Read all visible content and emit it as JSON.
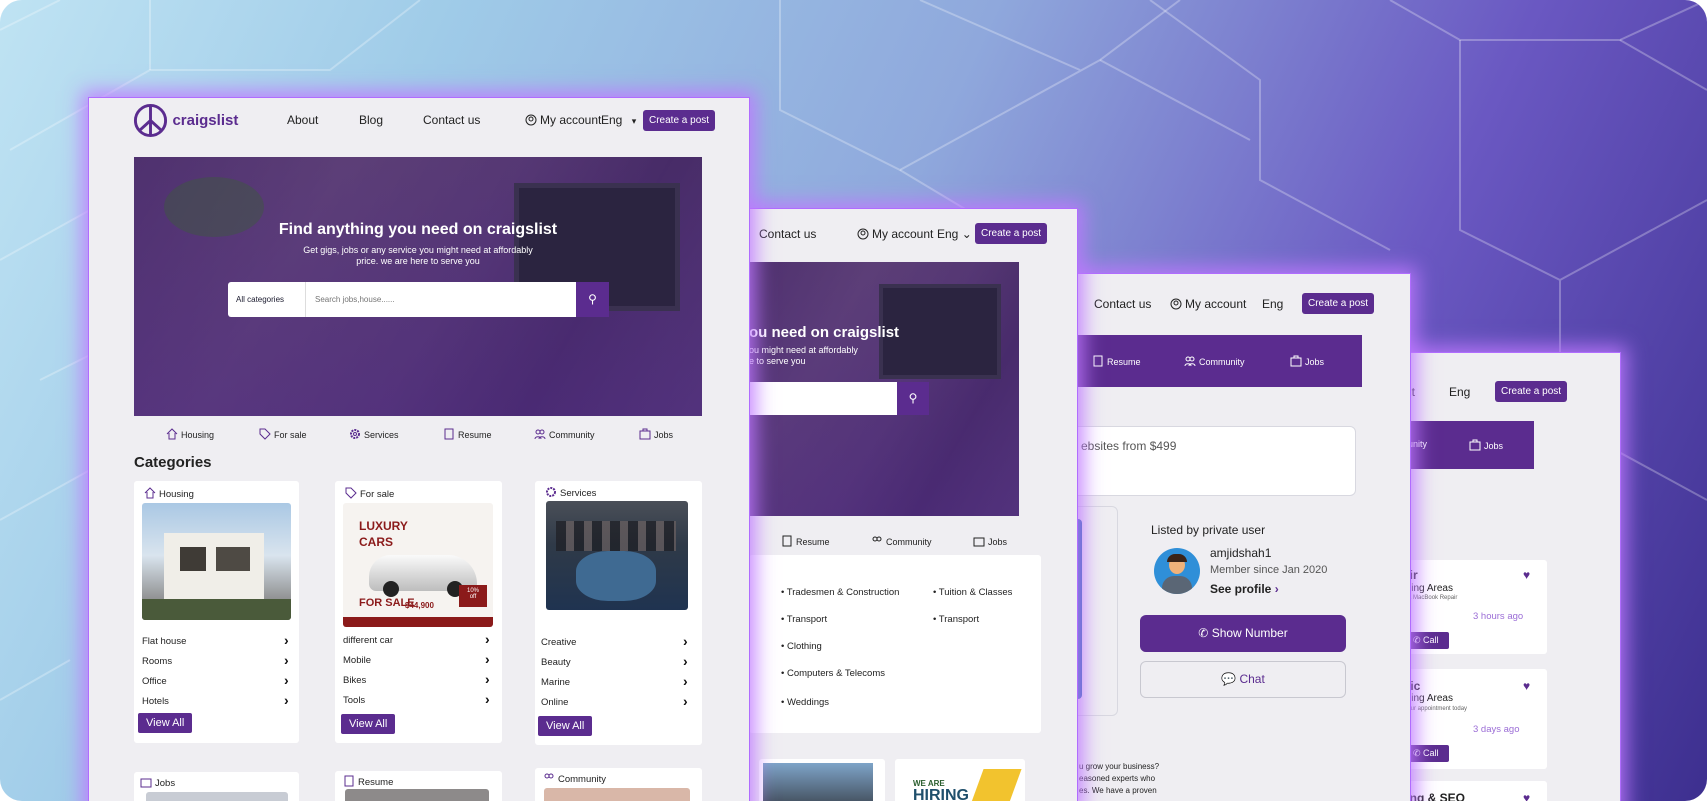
{
  "brand": "craigslist",
  "colors": {
    "accent": "#5b2c8f",
    "glow": "#b06cff"
  },
  "main": {
    "nav": [
      "About",
      "Blog",
      "Contact us"
    ],
    "account": "My account",
    "lang": "Eng",
    "create": "Create a post",
    "hero_title": "Find anything you need on craigslist",
    "hero_sub1": "Get gigs, jobs or any service you might need at affordably",
    "hero_sub2": "price. we are here to serve you",
    "cat_select": "All categories",
    "search_ph": "Search jobs,house......",
    "services": [
      "Housing",
      "For sale",
      "Services",
      "Resume",
      "Community",
      "Jobs"
    ],
    "categories_heading": "Categories",
    "cards": [
      {
        "title": "Housing",
        "items": [
          "Flat house",
          "Rooms",
          "Office",
          "Hotels"
        ]
      },
      {
        "title": "For sale",
        "items": [
          "different car",
          "Mobile",
          "Bikes",
          "Tools"
        ]
      },
      {
        "title": "Services",
        "items": [
          "Creative",
          "Beauty",
          "Marine",
          "Online"
        ]
      }
    ],
    "view_all": "View All",
    "ad": {
      "l1": "LUXURY",
      "l2": "CARS",
      "sale": "FOR SALE",
      "price": "$44,900",
      "off1": "10%",
      "off2": "off"
    },
    "bottom_cards": [
      "Jobs",
      "Resume",
      "Community"
    ]
  },
  "second": {
    "nav": "Contact us",
    "account": "My account",
    "lang": "Eng",
    "create": "Create a post",
    "hero_title": "ou need on craigslist",
    "hero_sub1": "ou might need at affordably",
    "hero_sub2": "e to serve you",
    "services": [
      "Resume",
      "Community",
      "Jobs"
    ],
    "list_left": [
      "Tradesmen & Construction",
      "Transport",
      "Clothing",
      "Computers & Telecoms",
      "Weddings"
    ],
    "list_right": [
      "Tuition & Classes",
      "Transport"
    ],
    "hiring1": "WE ARE",
    "hiring2": "HIRING"
  },
  "third": {
    "nav": "Contact us",
    "account": "My account",
    "lang": "Eng",
    "create": "Create a post",
    "services": [
      "Resume",
      "Community",
      "Jobs"
    ],
    "ad_text": "ebsites from $499",
    "listed_by": "Listed by private user",
    "user": "amjidshah1",
    "member": "Member since Jan 2020",
    "see_profile": "See profile",
    "show_number": "Show Number",
    "chat": "Chat",
    "desc": [
      "u grow your business?",
      "easoned experts who",
      "es. We have a proven"
    ]
  },
  "fourth": {
    "nav": "nt",
    "lang": "Eng",
    "create": "Create a post",
    "services": [
      "mmunity",
      "Jobs"
    ],
    "listings": [
      {
        "title": "epair",
        "sub": "ounding Areas",
        "small": "ndroid & MacBook Repair",
        "time": "3 hours ago",
        "call": "Call"
      },
      {
        "title": "hanic",
        "sub": "ounding Areas",
        "small": "Book your appointment today",
        "time": "3 days ago",
        "call": "Call"
      },
      {
        "title": "keting & SEO"
      }
    ]
  }
}
